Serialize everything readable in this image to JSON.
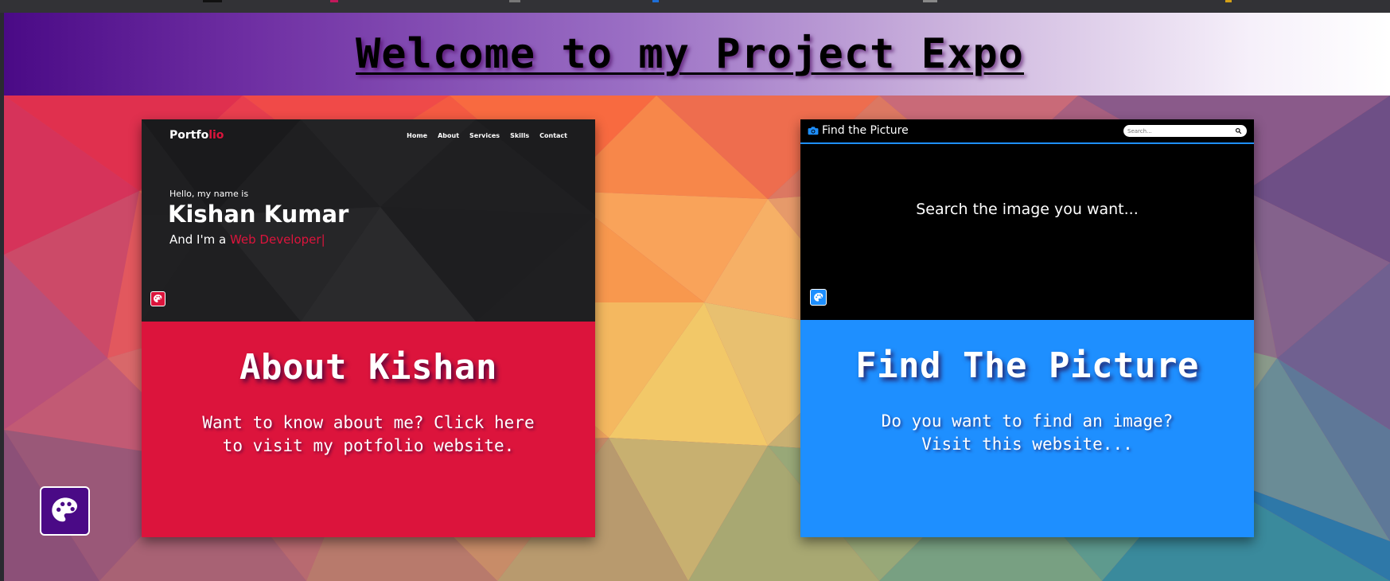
{
  "banner": {
    "title": "Welcome to my Project Expo"
  },
  "cards": [
    {
      "title": "About Kishan",
      "description": "Want to know about me? Click here to visit my potfolio website.",
      "preview": {
        "logo_main": "Portfo",
        "logo_accent": "lio",
        "nav": [
          "Home",
          "About",
          "Services",
          "Skills",
          "Contact"
        ],
        "greeting": "Hello, my name is",
        "name": "Kishan Kumar",
        "role_prefix": "And I'm a ",
        "role": "Web Developer|",
        "theme_icon": "palette-icon"
      }
    },
    {
      "title": "Find The Picture",
      "description": "Do you want to find an image? Visit this website...",
      "preview": {
        "brand": "Find the Picture",
        "brand_icon": "camera-icon",
        "search_placeholder": "Search...",
        "search_icon": "search-icon",
        "tagline": "Search the image you want...",
        "theme_icon": "palette-icon"
      }
    }
  ],
  "floating_button": {
    "icon": "palette-icon"
  },
  "colors": {
    "kishan_accent": "#dc143c",
    "picture_accent": "#1e8fff",
    "banner_purple": "#4a0a86"
  }
}
